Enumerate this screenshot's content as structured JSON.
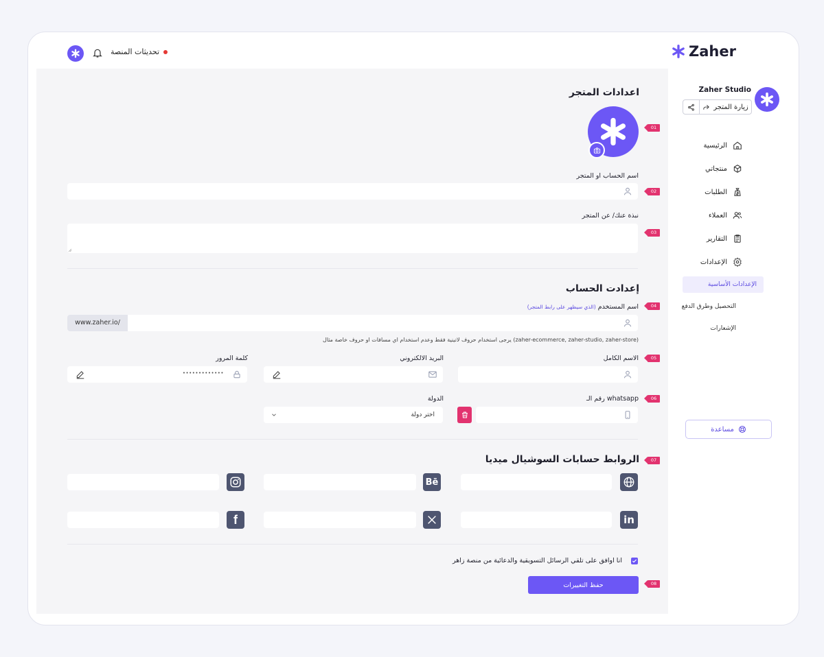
{
  "topbar": {
    "updates_label": "تحديثات المنصة"
  },
  "brand": {
    "name": "Zaher",
    "accent": "#6c57f5"
  },
  "sidebar": {
    "store_name": "Zaher Studio",
    "visit_label": "زيارة المتجر",
    "items": [
      {
        "label": "الرئيسية",
        "icon": "home-icon"
      },
      {
        "label": "منتجاتي",
        "icon": "box-icon"
      },
      {
        "label": "الطلبات",
        "icon": "money-bag-icon"
      },
      {
        "label": "العملاء",
        "icon": "users-icon"
      },
      {
        "label": "التقارير",
        "icon": "clipboard-icon"
      },
      {
        "label": "الإعدادات",
        "icon": "gear-icon"
      }
    ],
    "sub_items": [
      {
        "label": "الإعدادات الأساسية",
        "active": true
      },
      {
        "label": "التحصيل وطرق الدفع",
        "active": false
      },
      {
        "label": "الإشعارات",
        "active": false
      }
    ],
    "help_label": "مساعدة"
  },
  "store_settings": {
    "title": "اعدادات المتجر",
    "name_label": "اسم الحساب او المتجر",
    "bio_label": "نبذة عنك/ عن المتجر"
  },
  "account_settings": {
    "title": "إعدادت الحساب",
    "username_label": "اسم المستخدم",
    "username_hint": "(الذي سيظهر على رابط المتجر)",
    "url_prefix": "www.zaher.io/",
    "username_note": "يرجى استخدام حروف لاتينية فقط وعدم استخدام اي مسافات او حروف خاصة مثال (zaher-ecommerce, zaher-studio, zaher-store)",
    "fullname_label": "الاسم الكامل",
    "email_label": "البريد الالكتروني",
    "password_label": "كلمة المرور",
    "password_value": "•••••••••••••",
    "whatsapp_label": "رقم الـ whatsapp",
    "country_label": "الدولة",
    "country_placeholder": "اختر دولة"
  },
  "social": {
    "title": "الروابط حسابات السوشيال ميديا",
    "networks": [
      "globe-icon",
      "behance-icon",
      "instagram-icon",
      "linkedin-icon",
      "x-icon",
      "facebook-icon"
    ]
  },
  "consent_label": "انا اوافق على تلقي الرسائل التسويقية والدعائية من منصة زاهر",
  "save_label": "حفظ التغييرات",
  "badges": [
    "01",
    "02",
    "03",
    "04",
    "05",
    "06",
    "07",
    "08"
  ]
}
